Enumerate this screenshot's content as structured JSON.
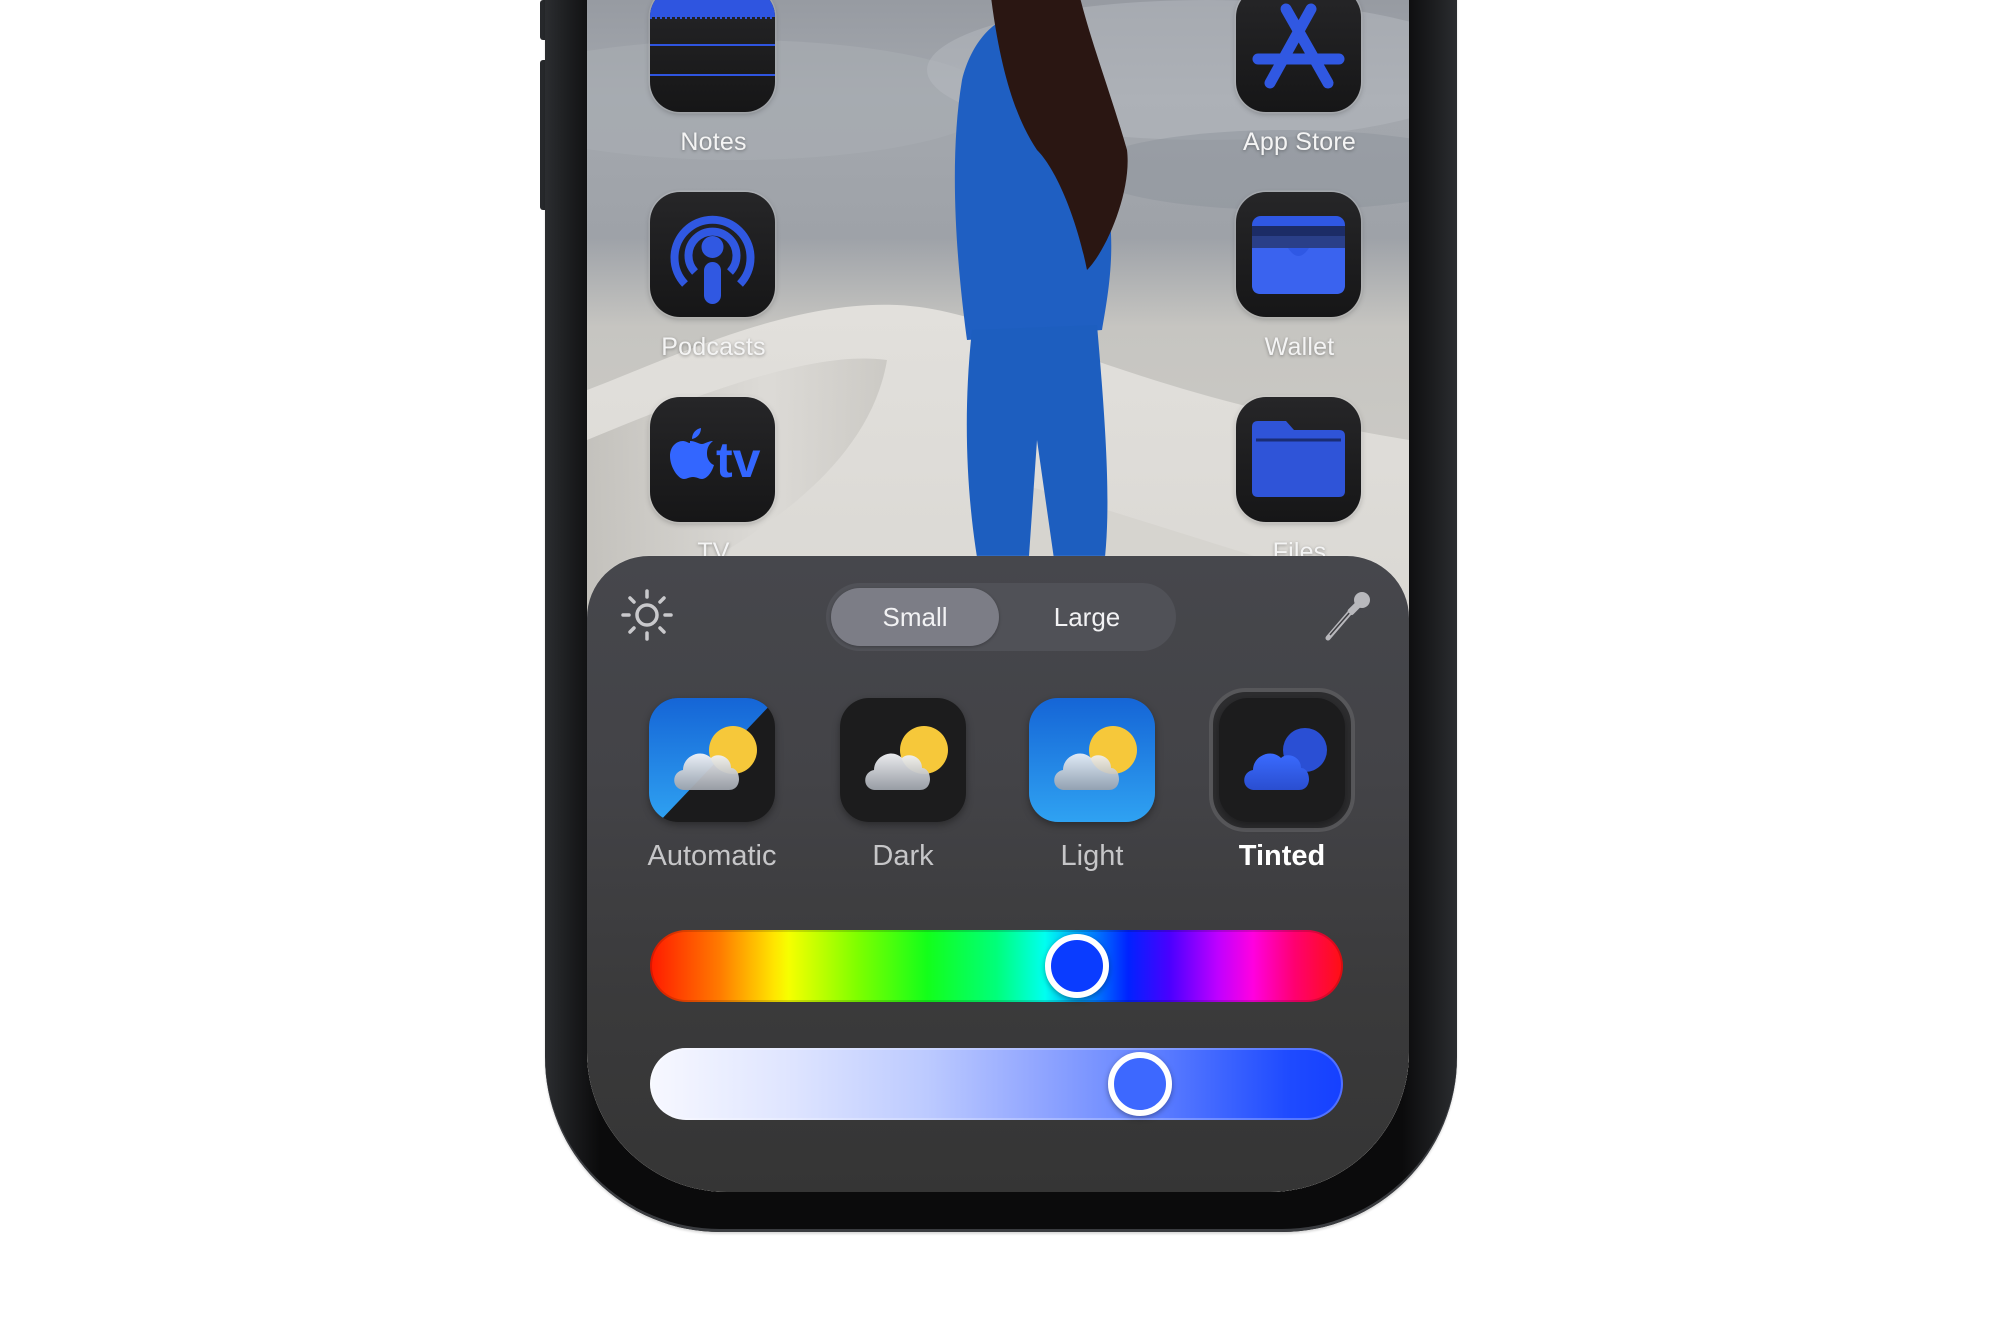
{
  "home_screen": {
    "apps": [
      {
        "label": "Notes",
        "icon": "notes-icon",
        "column": "left",
        "row": 1
      },
      {
        "label": "App Store",
        "icon": "app-store-icon",
        "column": "right",
        "row": 1
      },
      {
        "label": "Podcasts",
        "icon": "podcasts-icon",
        "column": "left",
        "row": 2
      },
      {
        "label": "Wallet",
        "icon": "wallet-icon",
        "column": "right",
        "row": 2
      },
      {
        "label": "TV",
        "icon": "apple-tv-icon",
        "column": "left",
        "row": 3
      },
      {
        "label": "Files",
        "icon": "files-icon",
        "column": "right",
        "row": 3
      }
    ],
    "tint_color": "#2f5cf0"
  },
  "customize_panel": {
    "brightness_icon": "sun-icon",
    "eyedropper_icon": "eyedropper-icon",
    "size_toggle": {
      "options": [
        "Small",
        "Large"
      ],
      "selected": "Small"
    },
    "styles": [
      {
        "label": "Automatic",
        "icon": "weather-automatic-icon",
        "selected": false
      },
      {
        "label": "Dark",
        "icon": "weather-dark-icon",
        "selected": false
      },
      {
        "label": "Light",
        "icon": "weather-light-icon",
        "selected": false
      },
      {
        "label": "Tinted",
        "icon": "weather-tinted-icon",
        "selected": true
      }
    ],
    "hue_slider": {
      "value": 0.63,
      "knob_color": "#0a3cff"
    },
    "saturation_slider": {
      "value": 0.73,
      "knob_color": "#3d68ff"
    }
  }
}
